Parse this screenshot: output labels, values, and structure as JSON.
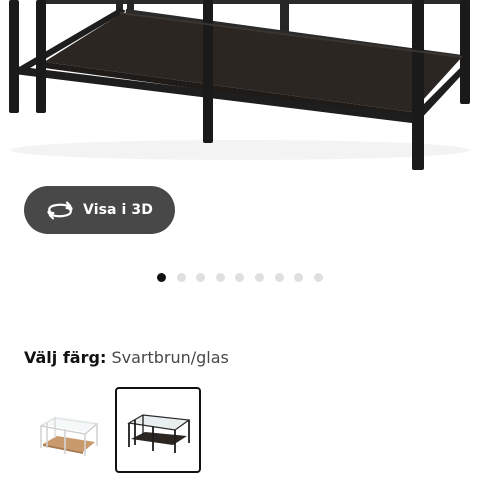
{
  "view3d": {
    "label": "Visa i 3D",
    "icon": "rotate-3d-icon"
  },
  "carousel": {
    "count": 9,
    "active_index": 0
  },
  "color_selector": {
    "label": "Välj färg:",
    "value": "Svartbrun/glas",
    "options": [
      {
        "variant": "white-oak-glass",
        "selected": false
      },
      {
        "variant": "black-brown-glass",
        "selected": true
      }
    ]
  },
  "colors": {
    "button_bg": "#484848",
    "dot_active": "#111111",
    "dot_inactive": "#dfdfdf",
    "frame": "#1e1e1e",
    "shelf": "#2a2520"
  }
}
